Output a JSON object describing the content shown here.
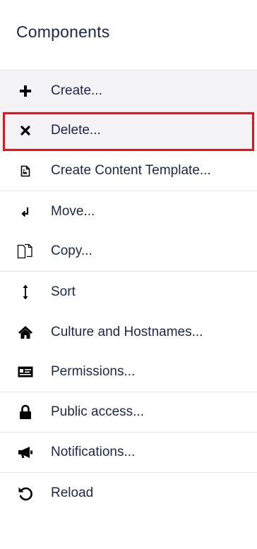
{
  "header": {
    "title": "Components"
  },
  "menu": {
    "items": [
      {
        "label": "Create...",
        "icon": "plus-icon"
      },
      {
        "label": "Delete...",
        "icon": "close-icon"
      },
      {
        "label": "Create Content Template...",
        "icon": "document-icon"
      },
      {
        "label": "Move...",
        "icon": "move-arrow-icon"
      },
      {
        "label": "Copy...",
        "icon": "copy-icon"
      },
      {
        "label": "Sort",
        "icon": "sort-arrows-icon"
      },
      {
        "label": "Culture and Hostnames...",
        "icon": "home-icon"
      },
      {
        "label": "Permissions...",
        "icon": "permissions-card-icon"
      },
      {
        "label": "Public access...",
        "icon": "lock-icon"
      },
      {
        "label": "Notifications...",
        "icon": "megaphone-icon"
      },
      {
        "label": "Reload",
        "icon": "reload-icon"
      }
    ]
  },
  "colors": {
    "text": "#1b264f",
    "hover_background": "#f3f3f5",
    "highlight_border": "#e8101a",
    "divider": "#e4e4e4"
  }
}
